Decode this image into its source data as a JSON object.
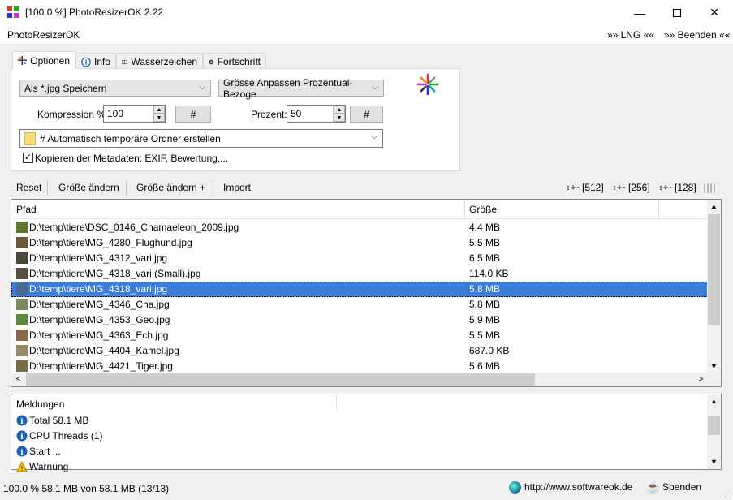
{
  "window": {
    "title": "[100.0 %] PhotoResizerOK 2.22"
  },
  "menu": {
    "app": "PhotoResizerOK",
    "lng": "»» LNG ««",
    "exit": "»» Beenden ««"
  },
  "tabs": [
    {
      "label": "Optionen",
      "icon": "grid-icon"
    },
    {
      "label": "Info",
      "icon": "info-icon"
    },
    {
      "label": "Wasserzeichen",
      "icon": "watermark-icon"
    },
    {
      "label": "Fortschritt",
      "icon": "progress-icon"
    }
  ],
  "options": {
    "save_format": "Als *.jpg Speichern",
    "resize_mode": "Grösse Anpassen Prozentual-Bezoge",
    "compression_label": "Kompression %:",
    "compression_value": "100",
    "percent_label": "Prozent:",
    "percent_value": "50",
    "hash_btn": "#",
    "folder": "# Automatisch temporäre Ordner erstellen",
    "metadata_label": "Kopieren der Metadaten: EXIF, Bewertung,...",
    "metadata_checked": true
  },
  "toolbar": {
    "reset": "Reset",
    "resize": "Größe ändern",
    "resize_plus": "Größe ändern +",
    "import": "Import",
    "size512": "[512]",
    "size256": "[256]",
    "size128": "[128]"
  },
  "filelist": {
    "col_path": "Pfad",
    "col_size": "Größe",
    "rows": [
      {
        "path": "D:\\temp\\tiere\\DSC_0146_Chamaeleon_2009.jpg",
        "size": "4.4 MB",
        "color": "#5c7a2a"
      },
      {
        "path": "D:\\temp\\tiere\\MG_4280_Flughund.jpg",
        "size": "5.5 MB",
        "color": "#6b5a3a"
      },
      {
        "path": "D:\\temp\\tiere\\MG_4312_vari.jpg",
        "size": "6.5 MB",
        "color": "#4a4a3a"
      },
      {
        "path": "D:\\temp\\tiere\\MG_4318_vari (Small).jpg",
        "size": "114.0 KB",
        "color": "#5a5040"
      },
      {
        "path": "D:\\temp\\tiere\\MG_4318_vari.jpg",
        "size": "5.8 MB",
        "color": "#4a6a8a",
        "selected": true
      },
      {
        "path": "D:\\temp\\tiere\\MG_4346_Cha.jpg",
        "size": "5.8 MB",
        "color": "#7a8a5a"
      },
      {
        "path": "D:\\temp\\tiere\\MG_4353_Geo.jpg",
        "size": "5.9 MB",
        "color": "#5a8a3a"
      },
      {
        "path": "D:\\temp\\tiere\\MG_4363_Ech.jpg",
        "size": "5.5 MB",
        "color": "#8a6a4a"
      },
      {
        "path": "D:\\temp\\tiere\\MG_4404_Kamel.jpg",
        "size": "687.0 KB",
        "color": "#9a8a6a"
      },
      {
        "path": "D:\\temp\\tiere\\MG_4421_Tiger.jpg",
        "size": "5.6 MB",
        "color": "#7a6a4a"
      }
    ]
  },
  "messages": {
    "header": "Meldungen",
    "rows": [
      {
        "text": "Total 58.1 MB",
        "icon": "info-icon"
      },
      {
        "text": "CPU Threads (1)",
        "icon": "info-icon"
      },
      {
        "text": "Start ...",
        "icon": "info-icon"
      },
      {
        "text": "Warnung",
        "icon": "warning-icon"
      }
    ]
  },
  "status": {
    "progress_text": "100.0 % 58.1 MB von 58.1 MB (13/13)",
    "url": "http://www.softwareok.de",
    "donate": "Spenden"
  },
  "colors": {
    "selection": "#3b7dd8",
    "info_icon": "#1a5fb4",
    "warning_icon": "#f5c400"
  }
}
